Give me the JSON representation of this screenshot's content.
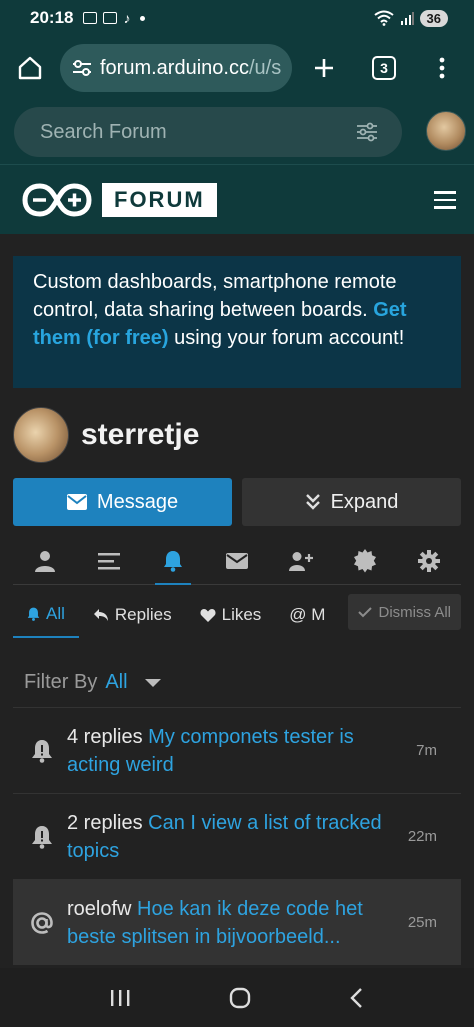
{
  "status_bar": {
    "time": "20:18",
    "battery": "36"
  },
  "browser": {
    "url_host": "forum.arduino.cc",
    "url_path": "/u/s",
    "tab_count": "3"
  },
  "forum_header": {
    "search_placeholder": "Search Forum",
    "logo_text": "FORUM"
  },
  "banner": {
    "text_before": "Custom dashboards, smartphone remote control, data sharing between boards. ",
    "link": "Get them (for free)",
    "text_after": " using your forum account!"
  },
  "profile": {
    "username": "sterretje",
    "message_label": "Message",
    "expand_label": "Expand"
  },
  "nav_icons": [
    "user-icon",
    "list-icon",
    "bell-icon",
    "envelope-icon",
    "user-plus-icon",
    "badge-icon",
    "gear-icon"
  ],
  "filter_tabs": {
    "all": "All",
    "replies": "Replies",
    "likes": "Likes",
    "mentions": "@ M",
    "dismiss": "Dismiss All"
  },
  "filter": {
    "label": "Filter By",
    "value": "All"
  },
  "notifications": [
    {
      "prefix": "4 replies",
      "link": "My componets tester is acting weird",
      "time": "7m",
      "icon": "bell-icon"
    },
    {
      "prefix": "2 replies",
      "link": "Can I view a list of tracked topics",
      "time": "22m",
      "icon": "bell-icon"
    },
    {
      "prefix": "roelofw",
      "link": "Hoe kan ik deze code het beste splitsen in bijvoorbeeld...",
      "time": "25m",
      "icon": "at-icon"
    }
  ],
  "colors": {
    "header_bg": "#0f3a3b",
    "accent": "#1e82be",
    "link": "#2ea3e0",
    "banner_bg": "#0c3547"
  }
}
